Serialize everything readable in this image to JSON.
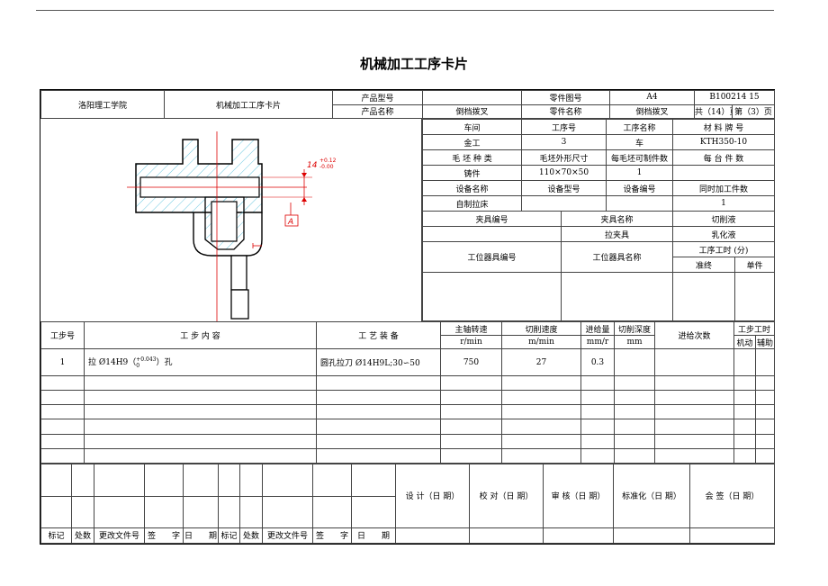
{
  "page_title": "机械加工工序卡片",
  "header": {
    "school": "洛阳理工学院",
    "card_title": "机械加工工序卡片",
    "product_model_label": "产品型号",
    "product_model_value": "",
    "part_drawing_label": "零件图号",
    "part_drawing_value": "A4",
    "doc_code": "B100214 15",
    "product_name_label": "产品名称",
    "product_name_value": "倒档拨叉",
    "part_name_label": "零件名称",
    "part_name_value": "倒档拨叉",
    "total_pages": "共（14）页",
    "page_no": "第（3）页"
  },
  "info": {
    "workshop_label": "车间",
    "process_no_label": "工序号",
    "process_name_label": "工序名称",
    "material_label": "材 料 牌 号",
    "workshop": "金工",
    "process_no": "3",
    "process_name": "车",
    "material": "KTH350-10",
    "blank_type_label": "毛 坯 种 类",
    "blank_size_label": "毛坯外形尺寸",
    "per_blank_label": "每毛坯可制件数",
    "per_machine_label": "每 台 件 数",
    "blank_type": "铸件",
    "blank_size": "110×70×50",
    "per_blank": "1",
    "per_machine": "",
    "equip_name_label": "设备名称",
    "equip_model_label": "设备型号",
    "equip_no_label": "设备编号",
    "simul_label": "同时加工件数",
    "equip_name": "自制拉床",
    "equip_model": "",
    "equip_no": "",
    "simul": "1",
    "fixture_no_label": "夹具编号",
    "fixture_name_label": "夹具名称",
    "coolant_label": "切削液",
    "fixture_no": "",
    "fixture_name": "拉夹具",
    "coolant": "乳化液",
    "station_no_label": "工位器具编号",
    "station_name_label": "工位器具名称",
    "time_label": "工序工时 (分)",
    "prep_label": "准终",
    "unit_label": "单件"
  },
  "drawing": {
    "dim_text": "14",
    "tol_upper": "+0.12",
    "tol_lower": "-0.00",
    "datum": "A"
  },
  "steps": {
    "col_no": "工步号",
    "col_content": "工 步 内 容",
    "col_equip": "工 艺 装 备",
    "col_speed": "主轴转速",
    "col_speed_unit": "r/min",
    "col_cut_speed": "切削速度",
    "col_cut_speed_unit": "m/min",
    "col_feed": "进给量",
    "col_feed_unit": "mm/r",
    "col_depth": "切削深度",
    "col_depth_unit": "mm",
    "col_passes": "进给次数",
    "col_time": "工步工时",
    "col_machine": "机动",
    "col_aux": "辅助",
    "rows": [
      {
        "no": "1",
        "content_pre": "拉 Ø14H9（",
        "tol_up": "+0.043",
        "tol_low": "0",
        "content_post": "）孔",
        "equip": "圆孔拉刀 Ø14H9L;30∽50",
        "speed": "750",
        "cut_speed": "27",
        "feed": "0.3",
        "depth": "",
        "passes": "",
        "machine": "",
        "aux": ""
      }
    ]
  },
  "signoff": {
    "design": "设 计（日 期）",
    "check": "校 对（日 期）",
    "review": "审 核（日 期）",
    "standard": "标准化（日 期）",
    "countersign": "会 签（日 期）",
    "mark": "标记",
    "count": "处数",
    "change_doc": "更改文件号",
    "sign": "签　　字",
    "date": "日　　期"
  }
}
